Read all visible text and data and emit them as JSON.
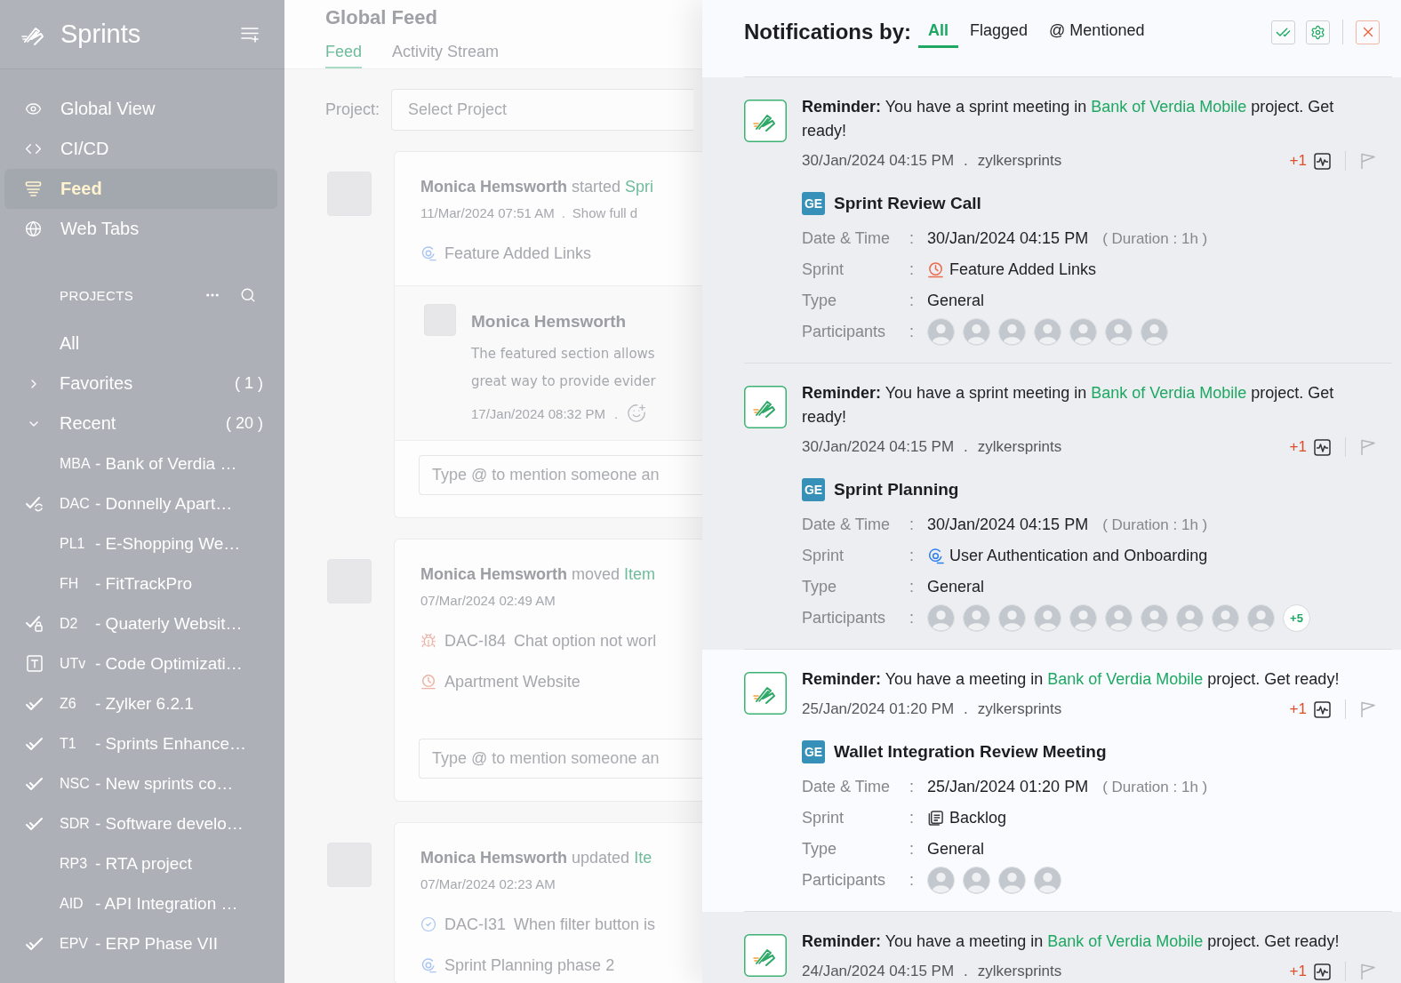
{
  "sidebar": {
    "app_name": "Sprints",
    "nav": [
      {
        "kind": "view",
        "label": "Global View",
        "selected": false
      },
      {
        "kind": "code",
        "label": "CI/CD",
        "selected": false
      },
      {
        "kind": "feed",
        "label": "Feed",
        "selected": true
      },
      {
        "kind": "web",
        "label": "Web Tabs",
        "selected": false
      }
    ],
    "projects_heading": "PROJECTS",
    "groups": [
      {
        "kind": "link",
        "label": "All"
      },
      {
        "kind": "folder",
        "label": "Favorites",
        "count": "( 1 )",
        "expanded": false
      },
      {
        "kind": "folder",
        "label": "Recent",
        "count": "( 20 )",
        "expanded": true
      }
    ],
    "projects": [
      {
        "kind": "plain",
        "code": "MBA",
        "name": "- Bank of Verdia …"
      },
      {
        "kind": "sync",
        "code": "DAC",
        "name": "- Donnelly Apart…"
      },
      {
        "kind": "plain",
        "code": "PL1",
        "name": "- E-Shopping We…"
      },
      {
        "kind": "plain",
        "code": "FH",
        "name": "- FitTrackPro"
      },
      {
        "kind": "locked",
        "code": "D2",
        "name": "- Quaterly Websit…"
      },
      {
        "kind": "template",
        "code": "UTv",
        "name": "- Code Optimizati…"
      },
      {
        "kind": "check",
        "code": "Z6",
        "name": "- Zylker 6.2.1"
      },
      {
        "kind": "check",
        "code": "T1",
        "name": "- Sprints Enhance…"
      },
      {
        "kind": "check",
        "code": "NSC",
        "name": "- New sprints co…"
      },
      {
        "kind": "check",
        "code": "SDR",
        "name": "- Software develo…"
      },
      {
        "kind": "plain",
        "code": "RP3",
        "name": "- RTA project"
      },
      {
        "kind": "plain",
        "code": "AID",
        "name": "- API Integration …"
      },
      {
        "kind": "check",
        "code": "EPV",
        "name": "- ERP Phase VII"
      }
    ]
  },
  "feed": {
    "title": "Global Feed",
    "tabs": [
      {
        "label": "Feed",
        "selected": true
      },
      {
        "label": "Activity Stream",
        "selected": false
      }
    ],
    "filter": {
      "label": "Project:",
      "placeholder": "Select Project"
    },
    "posts": [
      {
        "author": "Monica Hemsworth",
        "action": "started",
        "target": "Spri",
        "time": "11/Mar/2024 07:51 AM",
        "separator": ".",
        "more_link": "Show full d",
        "lines": [
          {
            "kind": "active",
            "text": "Feature Added Links"
          }
        ],
        "comment": {
          "author": "Monica Hemsworth",
          "lines": [
            "The featured section allows",
            "great way to provide evider"
          ],
          "time": "17/Jan/2024 08:32 PM",
          "separator": "."
        },
        "reply": {
          "placeholder": "Type @ to mention someone an"
        }
      },
      {
        "author": "Monica Hemsworth",
        "action": "moved",
        "target": "Item",
        "time": "07/Mar/2024 02:49 AM",
        "lines": [
          {
            "kind": "bug",
            "id": "DAC-I84",
            "text": "Chat option not worl"
          },
          {
            "kind": "upcoming",
            "text": "Apartment Website"
          }
        ],
        "reply": {
          "placeholder": "Type @ to mention someone an"
        }
      },
      {
        "author": "Monica Hemsworth",
        "action": "updated",
        "target": "Ite",
        "time": "07/Mar/2024 02:23 AM",
        "lines": [
          {
            "kind": "task",
            "id": "DAC-I31",
            "text": "When filter button is"
          },
          {
            "kind": "active",
            "text": "Sprint Planning phase 2"
          }
        ]
      }
    ]
  },
  "notifications": {
    "title": "Notifications by:",
    "tabs": [
      {
        "label": "All",
        "selected": true
      },
      {
        "label": "Flagged",
        "selected": false
      },
      {
        "label": "@ Mentioned",
        "selected": false
      }
    ],
    "items": [
      {
        "highlighted": false,
        "message": "**Reminder:** You have a sprint meeting in",
        "link": "Bank of Verdia Mobile",
        "message_end": "project. Get ready!",
        "time": "30/Jan/2024 04:15 PM",
        "separator": ".",
        "source": "zylkersprints",
        "count": "+1",
        "flagged": false,
        "event": {
          "badge": "GE",
          "title": "Sprint Review Call",
          "rows": [
            {
              "kind": "text",
              "label": "Date & Time",
              "colon": ":",
              "value": "30/Jan/2024 04:15 PM",
              "note": "( Duration : 1h )"
            },
            {
              "kind": "upcoming",
              "label": "Sprint",
              "colon": ":",
              "value": "Feature Added Links"
            },
            {
              "kind": "text",
              "label": "Type",
              "colon": ":",
              "value": "General"
            },
            {
              "kind": "people",
              "label": "Participants",
              "colon": ":",
              "people": [
                {
                  "kind": "photo"
                },
                {
                  "kind": "photo"
                },
                {
                  "kind": "photo"
                },
                {
                  "kind": "photo"
                },
                {
                  "kind": "photo"
                },
                {
                  "kind": "photo"
                },
                {
                  "kind": "photo"
                }
              ]
            }
          ]
        }
      },
      {
        "highlighted": false,
        "message": "**Reminder:** You have a sprint meeting in",
        "link": "Bank of Verdia Mobile",
        "message_end": "project. Get ready!",
        "time": "30/Jan/2024 04:15 PM",
        "separator": ".",
        "source": "zylkersprints",
        "count": "+1",
        "flagged": false,
        "event": {
          "badge": "GE",
          "title": "Sprint Planning",
          "rows": [
            {
              "kind": "text",
              "label": "Date & Time",
              "colon": ":",
              "value": "30/Jan/2024 04:15 PM",
              "note": "( Duration : 1h )"
            },
            {
              "kind": "active",
              "label": "Sprint",
              "colon": ":",
              "value": "User Authentication and Onboarding"
            },
            {
              "kind": "text",
              "label": "Type",
              "colon": ":",
              "value": "General"
            },
            {
              "kind": "people",
              "label": "Participants",
              "colon": ":",
              "people": [
                {
                  "kind": "photo"
                },
                {
                  "kind": "photo"
                },
                {
                  "kind": "photo"
                },
                {
                  "kind": "photo"
                },
                {
                  "kind": "photo"
                },
                {
                  "kind": "photo"
                },
                {
                  "kind": "photo"
                },
                {
                  "kind": "photo"
                },
                {
                  "kind": "photo"
                },
                {
                  "kind": "photo"
                }
              ],
              "more": "+5"
            }
          ]
        }
      },
      {
        "highlighted": true,
        "message": "**Reminder:** You have a meeting in",
        "link": "Bank of Verdia Mobile",
        "message_end": "project. Get ready!",
        "time": "25/Jan/2024 01:20 PM",
        "separator": ".",
        "source": "zylkersprints",
        "count": "+1",
        "flagged": false,
        "event": {
          "badge": "GE",
          "title": "Wallet Integration Review Meeting",
          "rows": [
            {
              "kind": "text",
              "label": "Date & Time",
              "colon": ":",
              "value": "25/Jan/2024 01:20 PM",
              "note": "( Duration : 1h )"
            },
            {
              "kind": "backlog",
              "label": "Sprint",
              "colon": ":",
              "value": "Backlog"
            },
            {
              "kind": "text",
              "label": "Type",
              "colon": ":",
              "value": "General"
            },
            {
              "kind": "people",
              "label": "Participants",
              "colon": ":",
              "people": [
                {
                  "kind": "photo"
                },
                {
                  "kind": "photo"
                },
                {
                  "kind": "photo"
                },
                {
                  "kind": "photo"
                }
              ]
            }
          ]
        }
      },
      {
        "highlighted": false,
        "message": "**Reminder:** You have a meeting in",
        "link": "Bank of Verdia Mobile",
        "message_end": "project. Get ready!",
        "time": "24/Jan/2024 04:15 PM",
        "separator": ".",
        "source": "zylkersprints",
        "count": "+1",
        "flagged": false
      }
    ]
  }
}
